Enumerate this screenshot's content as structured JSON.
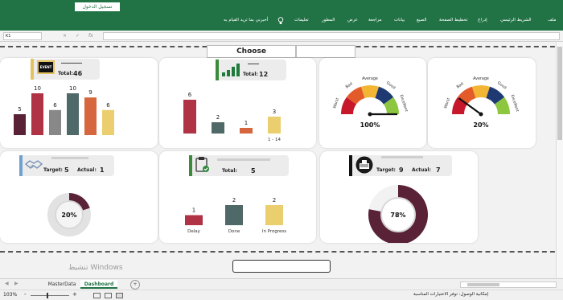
{
  "titlebar": {
    "signin_label": "تسجيل الدخول"
  },
  "ribbon": {
    "tabs": [
      "ملف",
      "الشريط الرئيسي",
      "إدراج",
      "تخطيط الصفحة",
      "الصيغ",
      "بيانات",
      "مراجعة",
      "عرض",
      "المطور",
      "تعليمات",
      "أخبرني بما تريد القيام به"
    ]
  },
  "formula": {
    "cell_ref": "K1",
    "cancel": "×",
    "enter": "✓",
    "fx": "fx"
  },
  "dashboard": {
    "choose_label": "Choose",
    "card1": {
      "icon_text": "EVENT",
      "total_label": "Total:",
      "total_value": "46"
    },
    "card2": {
      "total_label": "Total:",
      "total_value": "12"
    },
    "card4": {
      "target_label": "Target:",
      "target_value": "5",
      "actual_label": "Actual:",
      "actual_value": "1"
    },
    "card5": {
      "total_label": "Total:",
      "total_value": "5"
    },
    "card6": {
      "target_label": "Target:",
      "target_value": "9",
      "actual_label": "Actual:",
      "actual_value": "7"
    }
  },
  "chart_data": [
    {
      "type": "bar",
      "values": [
        5,
        10,
        6,
        10,
        9,
        6
      ],
      "colors": [
        "#5a2237",
        "#b03345",
        "#888888",
        "#4f6868",
        "#d5663d",
        "#ebcf6e"
      ]
    },
    {
      "type": "bar",
      "categories": [
        "",
        "",
        "",
        "1 - 14"
      ],
      "values": [
        6,
        2,
        1,
        3
      ],
      "colors": [
        "#b03345",
        "#4f6868",
        "#d5663d",
        "#ebcf6e"
      ]
    },
    {
      "type": "gauge",
      "categories": [
        "Worst",
        "Bad",
        "Average",
        "Good",
        "Excellent"
      ],
      "value_label": "100%",
      "percent": 100
    },
    {
      "type": "gauge",
      "categories": [
        "Worst",
        "Bad",
        "Average",
        "Good",
        "Excellent"
      ],
      "value_label": "20%",
      "percent": 20
    },
    {
      "type": "donut",
      "value_label": "20%",
      "percent": 20
    },
    {
      "type": "bar",
      "categories": [
        "Delay",
        "Done",
        "In Progress"
      ],
      "values": [
        1,
        2,
        2
      ],
      "colors": [
        "#b03345",
        "#4f6868",
        "#ebcf6e"
      ]
    },
    {
      "type": "donut",
      "value_label": "78%",
      "percent": 78
    }
  ],
  "sheets": {
    "tab1": "MasterData",
    "tab2": "Dashboard",
    "add": "+"
  },
  "watermark": {
    "line1": "تنشيط Windows"
  },
  "status": {
    "zoom": "103%",
    "minus": "-",
    "plus": "+",
    "text": "إمكانية الوصول: توفر الاختيارات المناسبة"
  },
  "colors": {
    "accent": "#217346",
    "maroon": "#5a2237"
  }
}
